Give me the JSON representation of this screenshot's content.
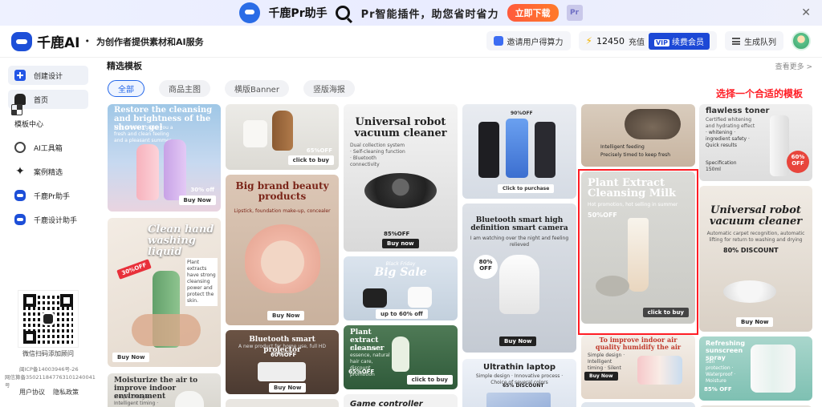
{
  "promo": {
    "product": "千鹿Pr助手",
    "slogan": "Pr智能插件，助您省时省力",
    "download": "立即下载",
    "badge": "Pr"
  },
  "header": {
    "brand": "千鹿AI",
    "tagline": "为创作者提供素材和AI服务",
    "invite": "邀请用户得算力",
    "credits": "12450",
    "recharge": "充值",
    "member_vip": "VIP",
    "member": "续费会员",
    "queue": "生成队列"
  },
  "sidebar": {
    "items": [
      {
        "label": "创建设计",
        "icon": "create-icon"
      },
      {
        "label": "首页",
        "icon": "home-icon"
      },
      {
        "label": "模板中心",
        "icon": "grid-icon"
      },
      {
        "label": "AI工具箱",
        "icon": "ai-toolbox-icon"
      },
      {
        "label": "案例精选",
        "icon": "sparkle-icon"
      },
      {
        "label": "千鹿Pr助手",
        "icon": "deer-icon"
      },
      {
        "label": "千鹿设计助手",
        "icon": "deer-icon"
      }
    ],
    "qr_label": "微信扫码添加顾问",
    "legal_1": "闽ICP备14003946号-26",
    "legal_2": "网信算备350211847763101240041号",
    "link_terms": "用户协议",
    "link_privacy": "隐私政策"
  },
  "main": {
    "title": "精选模板",
    "see_more": "查看更多 >",
    "tabs": [
      "全部",
      "商品主图",
      "横版Banner",
      "竖版海报"
    ],
    "hint": "选择一个合适的模板"
  },
  "cards": {
    "c1": {
      "title": "Restore the cleansing and brightness of the shower gel",
      "sub": "This product gives you a fresh and clean feeling and a pleasant summer",
      "badge": "30% off",
      "btn": "Buy Now"
    },
    "c2": {
      "title": "Clean hand washing liquid",
      "note": "Plant extracts have strong cleansing power and protect the skin.",
      "badge": "30%OFF",
      "btn": "Buy Now"
    },
    "c3": {
      "title": "Moisturize the air to improve indoor environment",
      "sub": "Simple design · Intelligent timing · Silent operation"
    },
    "c4": {
      "badge": "65%OFF",
      "btn": "click to buy"
    },
    "c5": {
      "title": "Big brand beauty products",
      "sub": "Lipstick, foundation make-up, concealer",
      "btn": "Buy Now"
    },
    "c6": {
      "title": "Bluetooth smart projector",
      "sub": "A new product for home use, full HD projector",
      "badge": "60%OFF",
      "btn": "Buy Now"
    },
    "c7": {
      "title": "Universal robot vacuum cleaner",
      "sub": "Dual collection system · Self-cleaning function · Bluetooth connectivity",
      "badge": "85%OFF",
      "btn": "Buy now"
    },
    "c8": {
      "kicker": "Black Friday",
      "title": "Big Sale",
      "btn": "up to 60% off"
    },
    "c9": {
      "title": "Plant extract cleanser",
      "sub": "Plant extract essence, natural hair care, discount promotion",
      "badge": "65%OFF",
      "btn": "click to buy"
    },
    "c10": {
      "title": "Game controller"
    },
    "c11": {
      "badge": "90%OFF",
      "btn": "Click to purchase"
    },
    "c12": {
      "title": "Bluetooth smart high definition smart camera",
      "sub": "I am watching over the night and feeling relieved",
      "badge": "80% OFF",
      "btn": "Buy Now"
    },
    "c13": {
      "title": "Ultrathin laptop",
      "sub": "Simple design · Innovative process · Choice of several colors",
      "badge": "65% DISCOUNT"
    },
    "c14": {
      "line1": "Intelligent feeding",
      "line2": "Precisely timed to keep fresh"
    },
    "c15": {
      "title": "Plant Extract Cleansing Milk",
      "sub": "Hot promotion, hot selling in summer",
      "badge": "50%OFF",
      "btn": "click to buy"
    },
    "c16": {
      "title": "To improve indoor air quality humidify the air",
      "sub": "Simple design · Intelligent timing · Silent operation",
      "btn": "Buy Now"
    },
    "c17": {
      "title": "flawless toner",
      "sub": "Certified whitening and hydrating effect",
      "points": "· whitening · ingredient safety · Quick results",
      "volume": "Specification 150ml",
      "badge": "60% OFF"
    },
    "c18": {
      "title": "Universal robot vacuum cleaner",
      "sub": "Automatic carpet recognition, automatic lifting for return to washing and drying",
      "badge": "80% DISCOUNT",
      "btn": "Buy Now"
    },
    "c19": {
      "title": "Refreshing sunscreen spray",
      "sub": "Sun protection · Waterproof · Moisture",
      "badge": "85% OFF"
    }
  },
  "colors": {
    "accent": "#2366e8",
    "highlight": "#ff1d25",
    "brand": "#1d4fd8"
  }
}
